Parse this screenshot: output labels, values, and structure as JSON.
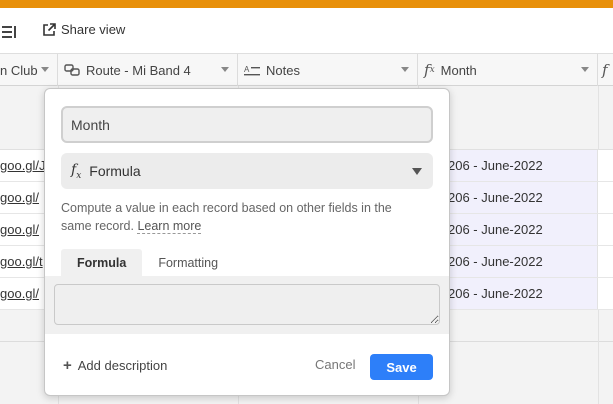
{
  "toolbar": {
    "share_label": "Share view"
  },
  "columns": [
    {
      "label": "n Club"
    },
    {
      "label": "Route - Mi Band 4"
    },
    {
      "label": "Notes"
    },
    {
      "label": "Month"
    },
    {
      "label": "f"
    }
  ],
  "rows": [
    {
      "link": "goo.gl/J",
      "month": "206 - June-2022"
    },
    {
      "link": "goo.gl/",
      "month": "206 - June-2022"
    },
    {
      "link": "goo.gl/",
      "month": "206 - June-2022"
    },
    {
      "link": "goo.gl/t",
      "month": "206 - June-2022"
    },
    {
      "link": "goo.gl/",
      "month": "206 - June-2022"
    }
  ],
  "popup": {
    "field_name": "Month",
    "field_type": "Formula",
    "description": "Compute a value in each record based on other fields in the same record.",
    "learn_more": "Learn more",
    "tabs": [
      {
        "label": "Formula",
        "active": true
      },
      {
        "label": "Formatting",
        "active": false
      }
    ],
    "formula_value": "",
    "add_description_label": "Add description",
    "cancel_label": "Cancel",
    "save_label": "Save"
  },
  "colors": {
    "topbar": "#e8900a",
    "save_button": "#2d7ff9",
    "formula_cell_bg": "#f1f0fc"
  }
}
